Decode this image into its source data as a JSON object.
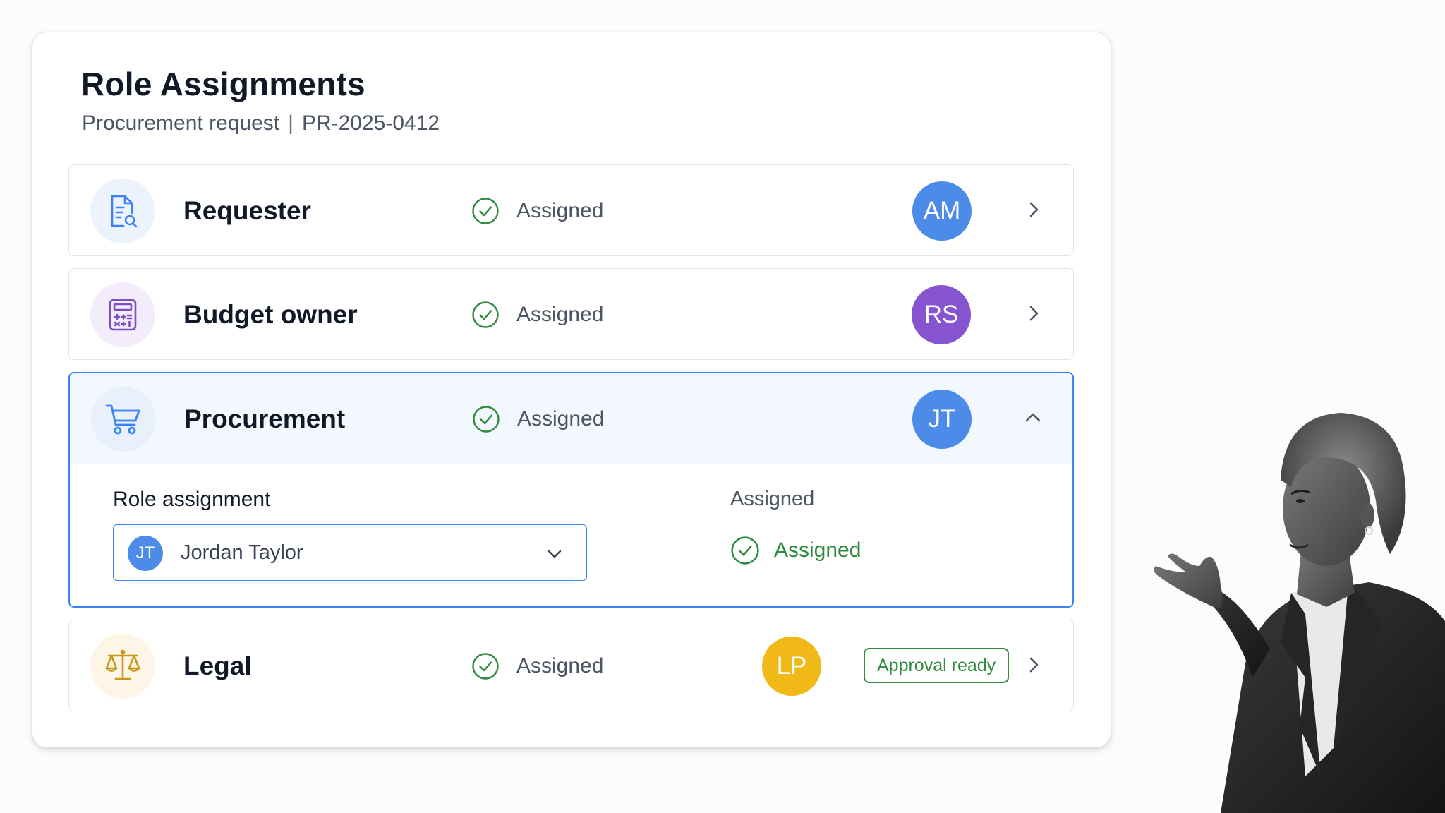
{
  "panel": {
    "title": "Role Assignments",
    "subtitle_type": "Procurement request",
    "subtitle_separator": "|",
    "subtitle_id": "PR-2025-0412"
  },
  "roles": [
    {
      "name": "Requester",
      "icon": "document-search-icon",
      "status": "Assigned",
      "avatar_initials": "AM",
      "avatar_color": "#4d8be8",
      "icon_bg": "#edf3fd",
      "icon_color": "#3b82f6"
    },
    {
      "name": "Budget owner",
      "icon": "calculator-icon",
      "status": "Assigned",
      "avatar_initials": "RS",
      "avatar_color": "#8654cf",
      "icon_bg": "#f3ecfb",
      "icon_color": "#7c4dc4"
    },
    {
      "name": "Procurement",
      "icon": "shopping-cart-icon",
      "status": "Assigned",
      "avatar_initials": "JT",
      "avatar_color": "#4d8be8",
      "icon_bg": "#e8f0fc",
      "icon_color": "#3b82f6",
      "expanded": true,
      "details": {
        "field_label": "Role assignment",
        "selected_initials": "JT",
        "selected_name": "Jordan Taylor",
        "status_label": "Assigned",
        "status_value": "Assigned"
      }
    },
    {
      "name": "Legal",
      "icon": "scales-icon",
      "status": "Assigned",
      "avatar_initials": "LP",
      "avatar_color": "#f0b918",
      "icon_bg": "#fdf6e6",
      "icon_color": "#c9961c",
      "badge": "Approval ready"
    }
  ],
  "colors": {
    "accent": "#3b82f6",
    "success": "#2f8a3c"
  }
}
